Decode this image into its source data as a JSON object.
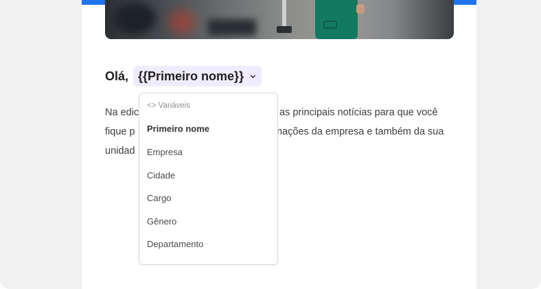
{
  "greeting": {
    "hello": "Olá,",
    "variable_chip_label": "{{Primeiro nome}}"
  },
  "body_text": {
    "line1_left": "Na edic",
    "line1_right": "as principais notícias para que você",
    "line2_left": "fique p",
    "line2_right": "nações da empresa e também da sua",
    "line3_left": "unidad"
  },
  "dropdown": {
    "header": "<> Variáveis",
    "items": [
      {
        "label": "Primeiro nome",
        "selected": true
      },
      {
        "label": "Empresa",
        "selected": false
      },
      {
        "label": "Cidade",
        "selected": false
      },
      {
        "label": "Cargo",
        "selected": false
      },
      {
        "label": "Gênero",
        "selected": false
      },
      {
        "label": "Departamento",
        "selected": false
      }
    ]
  },
  "colors": {
    "accent_bar": "#1f75f0",
    "chip_background": "#f1ecfd",
    "page_background": "#f1f1f1"
  },
  "icons": {
    "chip_dropdown": "chevron-down-icon"
  }
}
